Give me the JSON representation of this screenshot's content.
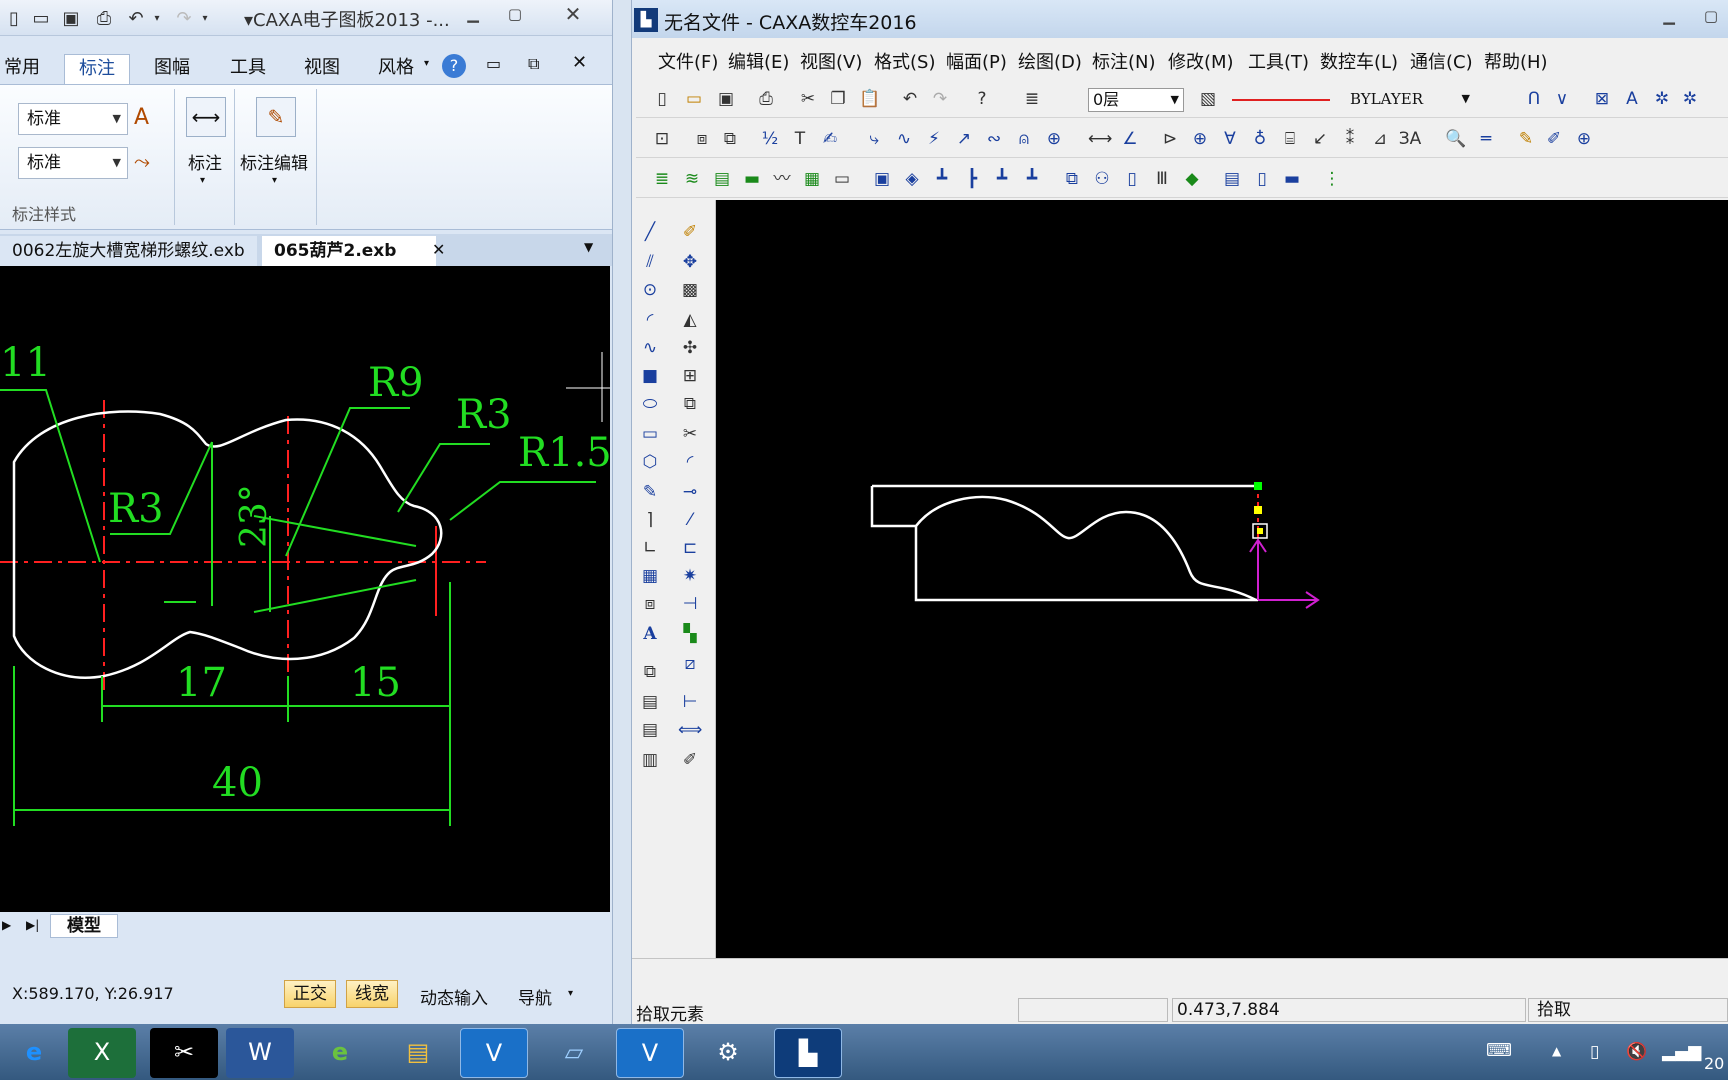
{
  "left_app": {
    "title": "▾CAXA电子图板2013 -...",
    "ribbon_tabs": [
      "常用",
      "标注",
      "图幅",
      "工具",
      "视图",
      "风格"
    ],
    "active_tab": "标注",
    "text_style_combo": "标准",
    "dim_style_combo": "标准",
    "group_label_dim": "标注",
    "group_label_dim_edit": "标注编辑",
    "group_label_style": "标注样式",
    "doc_tabs": [
      "0062左旋大槽宽梯形螺纹.exb",
      "065葫芦2.exb"
    ],
    "model_tab": "模型",
    "coords": "X:589.170, Y:26.917",
    "status_buttons": [
      "正交",
      "线宽"
    ],
    "status_texts": [
      "动态输入",
      "导航"
    ],
    "drawing_labels": {
      "d11": "11",
      "r9": "R9",
      "r3a": "R3",
      "r3b": "R3",
      "r15": "R1.5",
      "ang": "23°",
      "d17": "17",
      "d15": "15",
      "d40": "40"
    }
  },
  "right_app": {
    "title": "无名文件 - CAXA数控车2016",
    "menu": [
      "文件(F)",
      "编辑(E)",
      "视图(V)",
      "格式(S)",
      "幅面(P)",
      "绘图(D)",
      "标注(N)",
      "修改(M)",
      "工具(T)",
      "数控车(L)",
      "通信(C)",
      "帮助(H)"
    ],
    "layer_combo": "0层",
    "linetype_combo": "BYLAYER",
    "status_prompt": "拾取元素",
    "coords": "0.473,7.884",
    "status_right": "拾取",
    "accent_green": "#00ff00",
    "curve_color": "#ffffff"
  },
  "taskbar": {
    "items": [
      "ie-icon",
      "excel-icon",
      "capcut-icon",
      "word-icon",
      "ie2-icon",
      "explorer-icon",
      "caxa-v-icon",
      "notepad-icon",
      "caxa-v2-icon",
      "mastercam-icon",
      "caxa-lathe-icon"
    ],
    "clock_partial": "20"
  }
}
